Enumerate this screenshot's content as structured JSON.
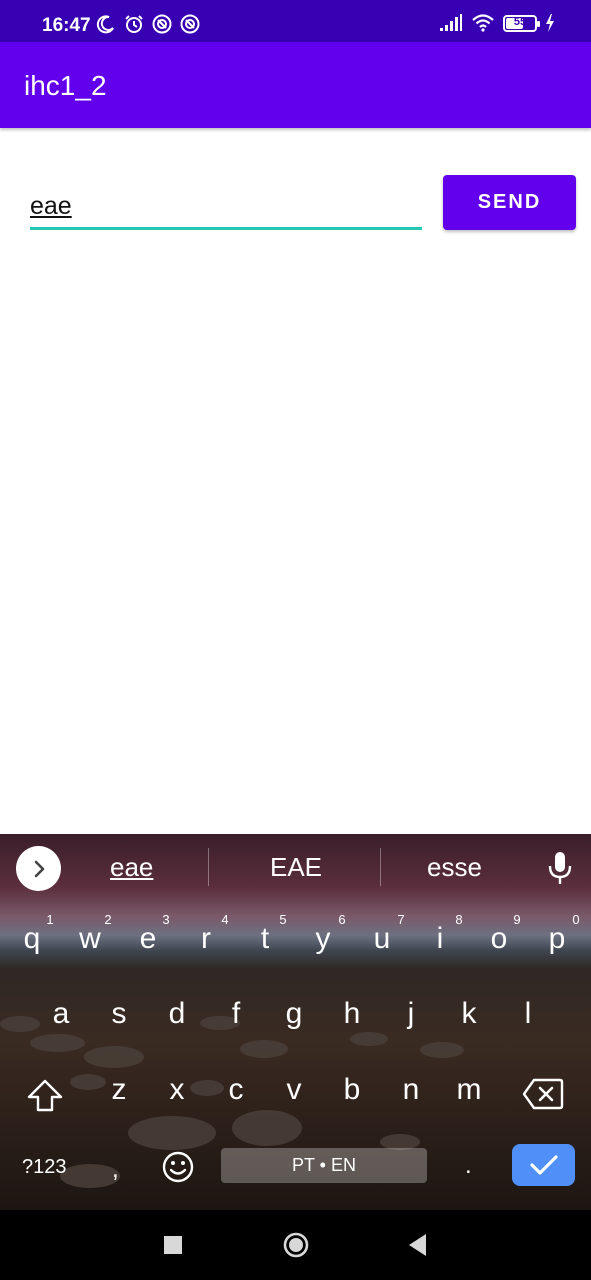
{
  "status_bar": {
    "time": "16:47",
    "battery": "55",
    "icons": [
      "moon-icon",
      "alarm-icon",
      "sync-icon",
      "sync-icon",
      "signal-icon",
      "wifi-icon",
      "battery-icon",
      "charging-icon"
    ]
  },
  "app_bar": {
    "title": "ihc1_2"
  },
  "message": {
    "value": "eae"
  },
  "send_button": {
    "label": "SEND"
  },
  "colors": {
    "primary": "#6200ee",
    "primary_dark": "#3700b3",
    "accent": "#26c6b4",
    "enter_key": "#4f8ff7"
  },
  "keyboard": {
    "suggestions": [
      "eae",
      "EAE",
      "esse"
    ],
    "row1": [
      "q",
      "w",
      "e",
      "r",
      "t",
      "y",
      "u",
      "i",
      "o",
      "p"
    ],
    "row1_hints": [
      "1",
      "2",
      "3",
      "4",
      "5",
      "6",
      "7",
      "8",
      "9",
      "0"
    ],
    "row2": [
      "a",
      "s",
      "d",
      "f",
      "g",
      "h",
      "j",
      "k",
      "l"
    ],
    "row3": [
      "z",
      "x",
      "c",
      "v",
      "b",
      "n",
      "m"
    ],
    "symbols": "?123",
    "comma": ",",
    "space": "PT • EN",
    "period": "."
  }
}
